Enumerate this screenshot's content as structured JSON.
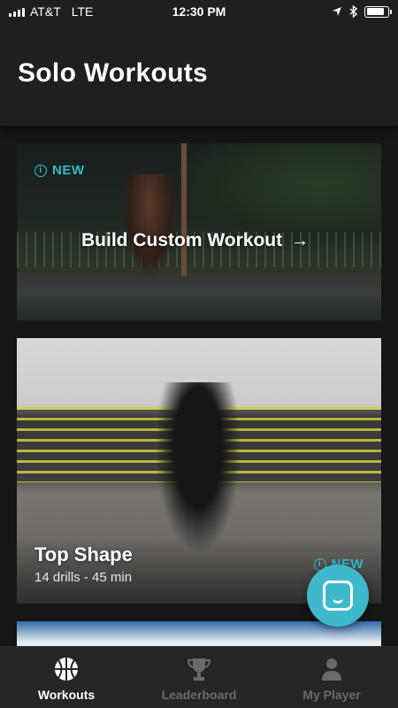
{
  "status_bar": {
    "carrier": "AT&T",
    "network": "LTE",
    "time": "12:30 PM",
    "battery_level": 0.85
  },
  "header": {
    "title": "Solo Workouts"
  },
  "cards": [
    {
      "badge": "NEW",
      "cta_label": "Build Custom Workout",
      "cta_icon": "arrow-right-icon"
    },
    {
      "title": "Top Shape",
      "meta": "14 drills - 45 min",
      "badge": "NEW"
    }
  ],
  "chat_button": {
    "icon": "chat-icon"
  },
  "tabs": [
    {
      "label": "Workouts",
      "icon": "basketball-icon",
      "active": true
    },
    {
      "label": "Leaderboard",
      "icon": "trophy-icon",
      "active": false
    },
    {
      "label": "My Player",
      "icon": "person-icon",
      "active": false
    }
  ],
  "colors": {
    "accent": "#35b6cc",
    "chat_button": "#40b8cc",
    "background": "#161616",
    "tab_inactive": "#6a6a6a"
  }
}
